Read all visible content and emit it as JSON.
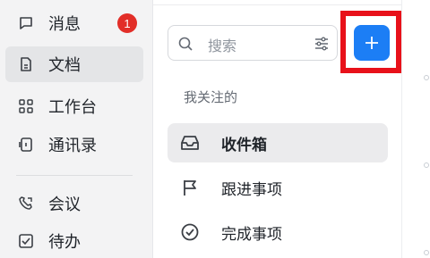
{
  "nav": {
    "items": [
      {
        "label": "消息",
        "icon": "message-icon",
        "badge": "1"
      },
      {
        "label": "文档",
        "icon": "document-icon"
      },
      {
        "label": "工作台",
        "icon": "workspace-grid-icon"
      },
      {
        "label": "通讯录",
        "icon": "contacts-icon"
      },
      {
        "label": "会议",
        "icon": "meeting-phone-icon"
      },
      {
        "label": "待办",
        "icon": "todo-check-icon"
      }
    ],
    "active_index": 1
  },
  "panel": {
    "search": {
      "placeholder": "搜索"
    },
    "add_button": {
      "glyph": "+"
    },
    "section_label": "我关注的",
    "items": [
      {
        "label": "收件箱",
        "icon": "inbox-icon"
      },
      {
        "label": "跟进事项",
        "icon": "flag-icon"
      },
      {
        "label": "完成事项",
        "icon": "check-circle-icon"
      }
    ],
    "active_index": 0
  },
  "colors": {
    "accent": "#1c7ef5",
    "badge": "#e22e28",
    "highlight": "#e8111a",
    "sidebar_bg": "#f3f3f4"
  }
}
